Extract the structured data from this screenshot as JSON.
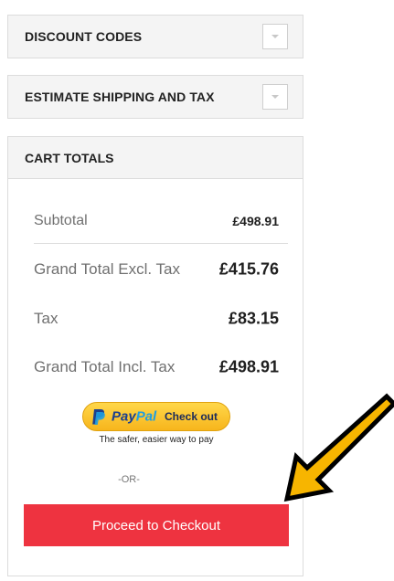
{
  "discount": {
    "title": "DISCOUNT CODES",
    "toggle_icon": "chevron-down-icon"
  },
  "shipping": {
    "title": "ESTIMATE SHIPPING AND TAX",
    "toggle_icon": "chevron-down-icon"
  },
  "cart_totals": {
    "title": "CART TOTALS",
    "rows": [
      {
        "label": "Subtotal",
        "value": "£498.91"
      },
      {
        "label": "Grand Total Excl. Tax",
        "value": "£415.76"
      },
      {
        "label": "Tax",
        "value": "£83.15"
      },
      {
        "label": "Grand Total Incl. Tax",
        "value": "£498.91"
      }
    ]
  },
  "paypal": {
    "brand_pay": "Pay",
    "brand_pal": "Pal",
    "checkout_label": "Check out",
    "tagline": "The safer, easier way to pay"
  },
  "separator": "-OR-",
  "checkout_button": "Proceed to Checkout",
  "colors": {
    "checkout_button": "#ee3340",
    "annotation_arrow": "#f7b500",
    "paypal_button": "#fcc439"
  }
}
